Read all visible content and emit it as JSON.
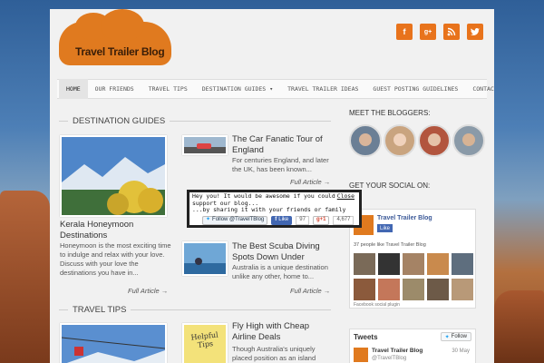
{
  "header": {
    "logo_text": "Travel Trailer Blog",
    "social": [
      {
        "icon": "facebook-icon",
        "glyph": "f"
      },
      {
        "icon": "google-plus-icon",
        "glyph": "g+"
      },
      {
        "icon": "rss-icon",
        "glyph": "rss"
      },
      {
        "icon": "twitter-icon",
        "glyph": "t"
      }
    ]
  },
  "nav": {
    "items": [
      "HOME",
      "OUR FRIENDS",
      "TRAVEL TIPS",
      "DESTINATION GUIDES",
      "TRAVEL TRAILER IDEAS",
      "GUEST POSTING GUIDELINES",
      "CONTACT"
    ],
    "dropdown_glyph": "▾"
  },
  "destination_guides": {
    "heading": "DESTINATION GUIDES",
    "featured": {
      "title": "Kerala Honeymoon Destinations",
      "excerpt": "Honeymoon is the most exciting time to indulge and relax with your love. Discuss with your love the destinations you have in...",
      "full_article": "Full Article →"
    },
    "posts": [
      {
        "title": "The Car Fanatic Tour of England",
        "excerpt": "For centuries England, and later the UK, has been known...",
        "full_article": "Full Article →"
      },
      {
        "title": "The Best Scuba Diving Spots Down Under",
        "excerpt": "Australia is a unique destination unlike any other, home to...",
        "full_article": "Full Article →"
      }
    ]
  },
  "travel_tips": {
    "heading": "TRAVEL TIPS",
    "post": {
      "title": "Fly High with Cheap Airline Deals",
      "excerpt": "Though Australia's uniquely placed position as an island",
      "sticky_note": "Helpful Tips"
    }
  },
  "sidebar": {
    "bloggers_heading": "MEET THE BLOGGERS:",
    "social_heading": "GET YOUR SOCIAL ON:",
    "fb_page_name": "Travel Trailer Blog",
    "fb_like": "Like",
    "fb_people": "37 people like Travel Trailer Blog",
    "fb_plugin": "Facebook social plugin",
    "tweets_label": "Tweets",
    "follow_label": "Follow",
    "tweet_name": "Travel Trailer Blog",
    "tweet_handle": "@TravelTBlog",
    "tweet_date": "30 May"
  },
  "popup": {
    "line1": "Hey you! It would be awesome if you could",
    "line2": "support our blog...",
    "line3": "...by sharing it with your friends or family",
    "close": "Close",
    "twitter_follow": "Follow @TravelTBlog",
    "fb_like": "Like",
    "fb_count": "97",
    "gplus_count": "4,677"
  },
  "colors": {
    "accent": "#e8731c",
    "fb_blue": "#3b5998"
  }
}
